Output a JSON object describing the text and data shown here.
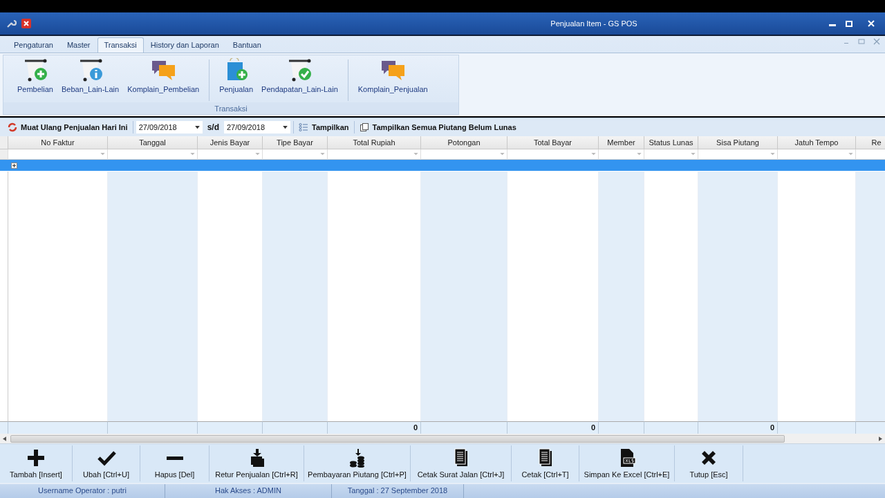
{
  "window": {
    "title": "Penjualan Item - GS POS"
  },
  "ribbon": {
    "tabs": [
      {
        "label": "Pengaturan",
        "selected": false
      },
      {
        "label": "Master",
        "selected": false
      },
      {
        "label": "Transaksi",
        "selected": true
      },
      {
        "label": "History dan Laporan",
        "selected": false
      },
      {
        "label": "Bantuan",
        "selected": false
      }
    ],
    "groups": [
      {
        "items": [
          {
            "label": "Pembelian",
            "kind": "cart_add"
          },
          {
            "label": "Beban_Lain-Lain",
            "kind": "cart_info"
          },
          {
            "label": "Komplain_Pembelian",
            "kind": "chat"
          }
        ]
      },
      {
        "items": [
          {
            "label": "Penjualan",
            "kind": "bag_add"
          },
          {
            "label": "Pendapatan_Lain-Lain",
            "kind": "cart_check"
          }
        ]
      },
      {
        "items": [
          {
            "label": "Komplain_Penjualan",
            "kind": "chat"
          }
        ]
      }
    ],
    "group_label": "Transaksi"
  },
  "toolbar": {
    "reload": "Muat Ulang Penjualan Hari Ini",
    "date_from": "27/09/2018",
    "separator": "s/d",
    "date_to": "27/09/2018",
    "show": "Tampilkan",
    "show_all": "Tampilkan Semua Piutang Belum Lunas"
  },
  "grid": {
    "columns": [
      {
        "title": "No Faktur"
      },
      {
        "title": "Tanggal"
      },
      {
        "title": "Jenis Bayar"
      },
      {
        "title": "Tipe Bayar"
      },
      {
        "title": "Total Rupiah",
        "total": "0"
      },
      {
        "title": "Potongan"
      },
      {
        "title": "Total Bayar",
        "total": "0"
      },
      {
        "title": "Member"
      },
      {
        "title": "Status Lunas"
      },
      {
        "title": "Sisa Piutang",
        "total": "0"
      },
      {
        "title": "Jatuh Tempo"
      },
      {
        "title": "Re"
      }
    ],
    "rows": [
      {
        "selected": true
      }
    ]
  },
  "buttons": [
    {
      "label": "Tambah [Insert]",
      "kind": "plus"
    },
    {
      "label": "Ubah [Ctrl+U]",
      "kind": "check"
    },
    {
      "label": "Hapus [Del]",
      "kind": "minus"
    },
    {
      "label": "Retur Penjualan [Ctrl+R]",
      "kind": "return"
    },
    {
      "label": "Pembayaran Piutang [Ctrl+P]",
      "kind": "coins"
    },
    {
      "label": "Cetak Surat Jalan [Ctrl+J]",
      "kind": "doc"
    },
    {
      "label": "Cetak [Ctrl+T]",
      "kind": "doc"
    },
    {
      "label": "Simpan Ke Excel [Ctrl+E]",
      "kind": "xls"
    },
    {
      "label": "Tutup [Esc]",
      "kind": "close"
    }
  ],
  "status_bar": [
    "Username Operator : putri",
    "Hak Akses : ADMIN",
    "Tanggal : 27 September 2018"
  ]
}
